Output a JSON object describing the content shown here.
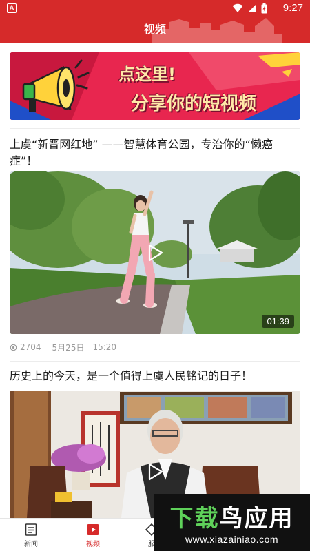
{
  "status_bar": {
    "time": "9:27",
    "left_icon": "A"
  },
  "header": {
    "title": "视频"
  },
  "banner": {
    "line1": "点这里!",
    "line2": "分享你的短视频"
  },
  "articles": [
    {
      "title": "上虞“新晋网红地” ——智慧体育公园，专治你的“懒癌症”！",
      "duration": "01:39",
      "views": "2704",
      "date": "5月25日",
      "time": "15:20"
    },
    {
      "title": "历史上的今天，是一个值得上虞人民铭记的日子！"
    }
  ],
  "bottom_nav": {
    "items": [
      {
        "label": "新闻",
        "icon": "news-icon",
        "active": false
      },
      {
        "label": "视频",
        "icon": "video-icon",
        "active": true
      },
      {
        "label": "服",
        "icon": "service-icon",
        "active": false
      }
    ]
  },
  "watermark": {
    "logo_part1": "下载",
    "logo_part2": "鸟应用",
    "url": "www.xiazainiao.com"
  },
  "colors": {
    "brand_red": "#d62a2a",
    "meta_gray": "#9a9a9a"
  }
}
